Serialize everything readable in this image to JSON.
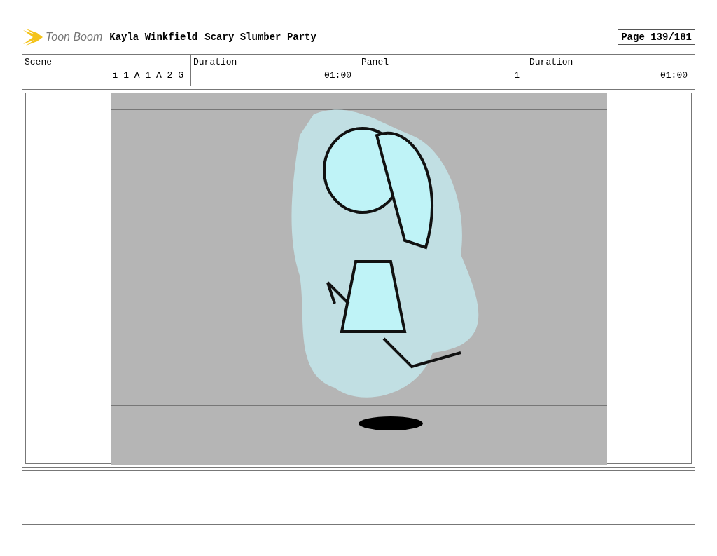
{
  "header": {
    "logo_text": "Toon Boom",
    "author": "Kayla Winkfield",
    "project": "Scary Slumber Party",
    "page": "Page 139/181"
  },
  "fields": [
    {
      "label": "Scene",
      "value": "i_1_A_1_A_2_G"
    },
    {
      "label": "Duration",
      "value": "01:00"
    },
    {
      "label": "Panel",
      "value": "1"
    },
    {
      "label": "Duration",
      "value": "01:00"
    }
  ]
}
